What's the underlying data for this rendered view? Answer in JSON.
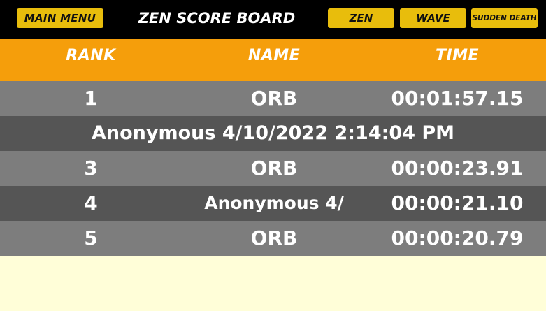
{
  "topbar": {
    "main_menu_label": "MAIN MENU",
    "title": "ZEN SCORE BOARD",
    "modes": [
      "ZEN",
      "WAVE",
      "SUDDEN DEATH"
    ]
  },
  "table": {
    "columns": [
      "RANK",
      "NAME",
      "TIME"
    ],
    "rows": [
      {
        "rank": "1",
        "name": "ORB",
        "time": "00:01:57.15"
      },
      {
        "text": "Anonymous 4/10/2022 2:14:04 PM"
      },
      {
        "rank": "3",
        "name": "ORB",
        "time": "00:00:23.91"
      },
      {
        "rank": "4",
        "name": "Anonymous 4/",
        "time": "00:00:21.10"
      },
      {
        "rank": "5",
        "name": "ORB",
        "time": "00:00:20.79"
      }
    ]
  },
  "colors": {
    "topbar": "#000000",
    "button": "#e8bd0c",
    "header": "#f59e0b",
    "row_light": "#7d7d7d",
    "row_dark": "#555555",
    "background": "#fffed8"
  }
}
